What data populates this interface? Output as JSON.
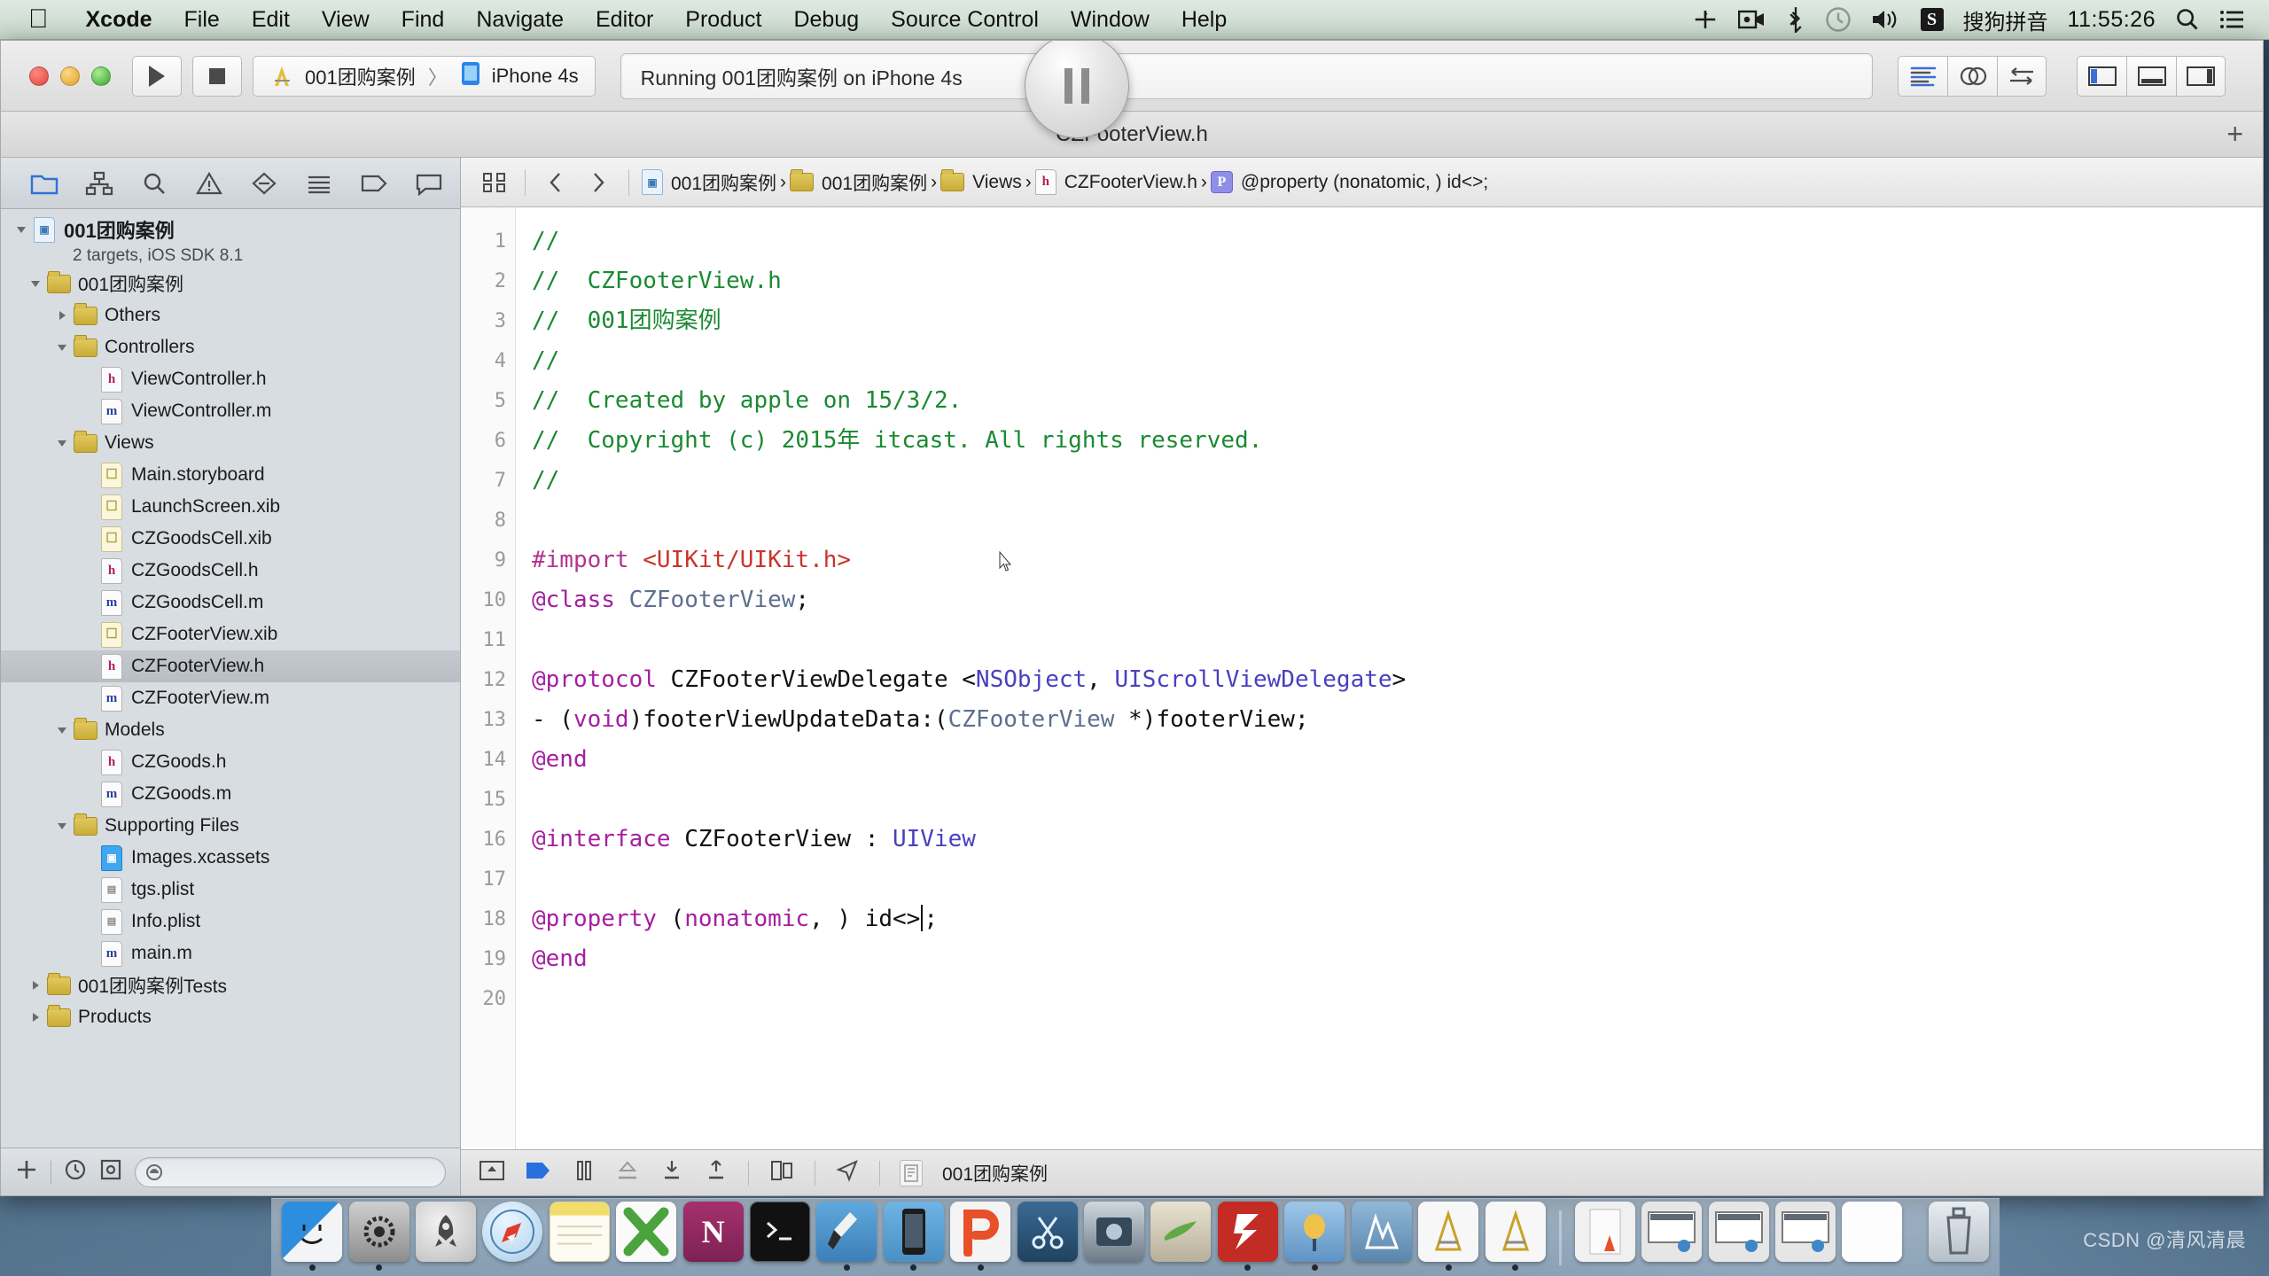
{
  "menubar": {
    "apple_icon": "apple-logo-icon",
    "items": [
      {
        "label": "Xcode",
        "bold": true
      },
      {
        "label": "File",
        "bold": false
      },
      {
        "label": "Edit",
        "bold": false
      },
      {
        "label": "View",
        "bold": false
      },
      {
        "label": "Find",
        "bold": false
      },
      {
        "label": "Navigate",
        "bold": false
      },
      {
        "label": "Editor",
        "bold": false
      },
      {
        "label": "Product",
        "bold": false
      },
      {
        "label": "Debug",
        "bold": false
      },
      {
        "label": "Source Control",
        "bold": false
      },
      {
        "label": "Window",
        "bold": false
      },
      {
        "label": "Help",
        "bold": false
      }
    ],
    "status": {
      "input_method": "搜狗拼音",
      "sogou_badge": "S",
      "clock": "11:55:26",
      "icons": [
        "airplay-icon",
        "screen-recording-icon",
        "bluetooth-icon",
        "time-machine-icon",
        "volume-icon",
        "spotlight-search-icon",
        "notification-center-icon"
      ]
    }
  },
  "toolbar": {
    "run_button": "run-icon",
    "stop_button": "stop-icon",
    "scheme": {
      "project": "001团购案例",
      "separator": "〉",
      "destination": "iPhone 4s"
    },
    "status_text": "Running 001团购案例 on iPhone 4s",
    "pause_button": "pause-icon",
    "editor_modes": [
      "standard-editor-icon",
      "assistant-editor-icon",
      "version-editor-icon"
    ],
    "view_toggles": [
      "toggle-navigator-icon",
      "toggle-debug-area-icon",
      "toggle-utilities-icon"
    ]
  },
  "titlebar": {
    "title": "CZFooterView.h",
    "add_tab": "+"
  },
  "navigator": {
    "tabs": [
      "project-navigator-icon",
      "symbol-navigator-icon",
      "find-navigator-icon",
      "issue-navigator-icon",
      "test-navigator-icon",
      "debug-navigator-icon",
      "breakpoint-navigator-icon",
      "report-navigator-icon"
    ],
    "project": {
      "name": "001团购案例",
      "subtitle": "2 targets, iOS SDK 8.1"
    },
    "tree": [
      {
        "label": "001团购案例",
        "kind": "folder",
        "depth": 1,
        "twisty": "down",
        "selected": false
      },
      {
        "label": "Others",
        "kind": "folder",
        "depth": 2,
        "twisty": "right",
        "selected": false
      },
      {
        "label": "Controllers",
        "kind": "folder",
        "depth": 2,
        "twisty": "down",
        "selected": false
      },
      {
        "label": "ViewController.h",
        "kind": "h",
        "depth": 3,
        "twisty": "none",
        "selected": false
      },
      {
        "label": "ViewController.m",
        "kind": "m",
        "depth": 3,
        "twisty": "none",
        "selected": false
      },
      {
        "label": "Views",
        "kind": "folder",
        "depth": 2,
        "twisty": "down",
        "selected": false
      },
      {
        "label": "Main.storyboard",
        "kind": "xib",
        "depth": 3,
        "twisty": "none",
        "selected": false
      },
      {
        "label": "LaunchScreen.xib",
        "kind": "xib",
        "depth": 3,
        "twisty": "none",
        "selected": false
      },
      {
        "label": "CZGoodsCell.xib",
        "kind": "xib",
        "depth": 3,
        "twisty": "none",
        "selected": false
      },
      {
        "label": "CZGoodsCell.h",
        "kind": "h",
        "depth": 3,
        "twisty": "none",
        "selected": false
      },
      {
        "label": "CZGoodsCell.m",
        "kind": "m",
        "depth": 3,
        "twisty": "none",
        "selected": false
      },
      {
        "label": "CZFooterView.xib",
        "kind": "xib",
        "depth": 3,
        "twisty": "none",
        "selected": false
      },
      {
        "label": "CZFooterView.h",
        "kind": "h",
        "depth": 3,
        "twisty": "none",
        "selected": true
      },
      {
        "label": "CZFooterView.m",
        "kind": "m",
        "depth": 3,
        "twisty": "none",
        "selected": false
      },
      {
        "label": "Models",
        "kind": "folder",
        "depth": 2,
        "twisty": "down",
        "selected": false
      },
      {
        "label": "CZGoods.h",
        "kind": "h",
        "depth": 3,
        "twisty": "none",
        "selected": false
      },
      {
        "label": "CZGoods.m",
        "kind": "m",
        "depth": 3,
        "twisty": "none",
        "selected": false
      },
      {
        "label": "Supporting Files",
        "kind": "folder",
        "depth": 2,
        "twisty": "down",
        "selected": false
      },
      {
        "label": "Images.xcassets",
        "kind": "xcassets",
        "depth": 3,
        "twisty": "none",
        "selected": false
      },
      {
        "label": "tgs.plist",
        "kind": "plist",
        "depth": 3,
        "twisty": "none",
        "selected": false
      },
      {
        "label": "Info.plist",
        "kind": "plist",
        "depth": 3,
        "twisty": "none",
        "selected": false
      },
      {
        "label": "main.m",
        "kind": "m",
        "depth": 3,
        "twisty": "none",
        "selected": false
      },
      {
        "label": "001团购案例Tests",
        "kind": "folder",
        "depth": 1,
        "twisty": "right",
        "selected": false
      },
      {
        "label": "Products",
        "kind": "folder",
        "depth": 1,
        "twisty": "right",
        "selected": false
      }
    ],
    "footer": {
      "add_button": "add-icon",
      "recent_button": "recent-files-icon",
      "source_control_button": "source-control-filter-icon",
      "filter_placeholder": ""
    }
  },
  "jumpbar": {
    "related_items": "related-items-icon",
    "back": "back-chevron-icon",
    "forward": "forward-chevron-icon",
    "crumbs": [
      {
        "label": "001团购案例",
        "icon": "project-icon"
      },
      {
        "label": "001团购案例",
        "icon": "folder-icon"
      },
      {
        "label": "Views",
        "icon": "folder-icon"
      },
      {
        "label": "CZFooterView.h",
        "icon": "header-file-icon"
      },
      {
        "label": "@property (nonatomic, ) id<>;",
        "icon": "property-icon"
      }
    ]
  },
  "editor": {
    "line_numbers": [
      "1",
      "2",
      "3",
      "4",
      "5",
      "6",
      "7",
      "8",
      "9",
      "10",
      "11",
      "12",
      "13",
      "14",
      "15",
      "16",
      "17",
      "18",
      "19",
      "20"
    ],
    "lines": [
      "//",
      "//  CZFooterView.h",
      "//  001团购案例",
      "//",
      "//  Created by apple on 15/3/2.",
      "//  Copyright (c) 2015年 itcast. All rights reserved.",
      "//",
      "",
      "#import <UIKit/UIKit.h>",
      "@class CZFooterView;",
      "",
      "@protocol CZFooterViewDelegate <NSObject, UIScrollViewDelegate>",
      "- (void)footerViewUpdateData:(CZFooterView *)footerView;",
      "@end",
      "",
      "@interface CZFooterView : UIView",
      "",
      "@property (nonatomic, ) id<>;",
      "@end",
      ""
    ]
  },
  "debugbar": {
    "icons": [
      "hide-debug-area-icon",
      "continue-icon",
      "pause-icon",
      "step-over-icon",
      "step-into-icon",
      "step-out-icon",
      "view-debugging-icon",
      "location-simulation-icon"
    ],
    "process_label": "001团购案例"
  },
  "dock": {
    "items": [
      {
        "name": "finder",
        "running": true
      },
      {
        "name": "system-preferences",
        "running": true
      },
      {
        "name": "launchpad",
        "running": false
      },
      {
        "name": "safari",
        "running": false
      },
      {
        "name": "notes",
        "running": false
      },
      {
        "name": "microsoft-excel",
        "running": false
      },
      {
        "name": "microsoft-onenote",
        "running": false
      },
      {
        "name": "terminal",
        "running": false
      },
      {
        "name": "xcode",
        "running": true
      },
      {
        "name": "ios-simulator",
        "running": true
      },
      {
        "name": "parallels-desktop",
        "running": true
      },
      {
        "name": "snipaste",
        "running": false
      },
      {
        "name": "quicktime-player",
        "running": false
      },
      {
        "name": "sublime-text",
        "running": false
      },
      {
        "name": "filezilla",
        "running": true
      },
      {
        "name": "charles",
        "running": true
      },
      {
        "name": "dash",
        "running": false
      },
      {
        "name": "instruments",
        "running": true
      },
      {
        "name": "instruments-2",
        "running": true
      }
    ],
    "stack_items": [
      {
        "name": "document-folder"
      },
      {
        "name": "minimized-window-1"
      },
      {
        "name": "minimized-window-2"
      },
      {
        "name": "minimized-window-3"
      },
      {
        "name": "minimized-window-4"
      }
    ],
    "trash": "trash-icon"
  },
  "watermark": "CSDN @清风清晨"
}
